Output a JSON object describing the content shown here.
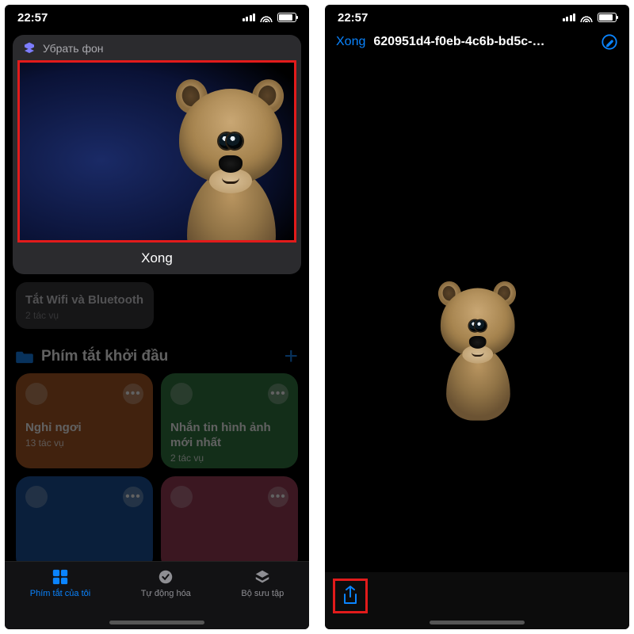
{
  "status": {
    "time": "22:57"
  },
  "left": {
    "card": {
      "title": "Убрать фон",
      "done": "Xong"
    },
    "wifi_card": {
      "title": "Tắt Wifi và Bluetooth",
      "subtitle": "2 tác vụ"
    },
    "section": {
      "title": "Phím tắt khởi đầu"
    },
    "tiles": [
      {
        "title": "Nghỉ ngơi",
        "subtitle": "13 tác vụ"
      },
      {
        "title": "Nhắn tin hình ảnh mới nhất",
        "subtitle": "2 tác vụ"
      },
      {
        "title": "",
        "subtitle": ""
      },
      {
        "title": "",
        "subtitle": ""
      }
    ],
    "tabs": {
      "mine": "Phím tắt của tôi",
      "automation": "Tự động hóa",
      "gallery": "Bộ sưu tập"
    }
  },
  "right": {
    "done": "Xong",
    "filename": "620951d4-f0eb-4c6b-bd5c-…"
  }
}
